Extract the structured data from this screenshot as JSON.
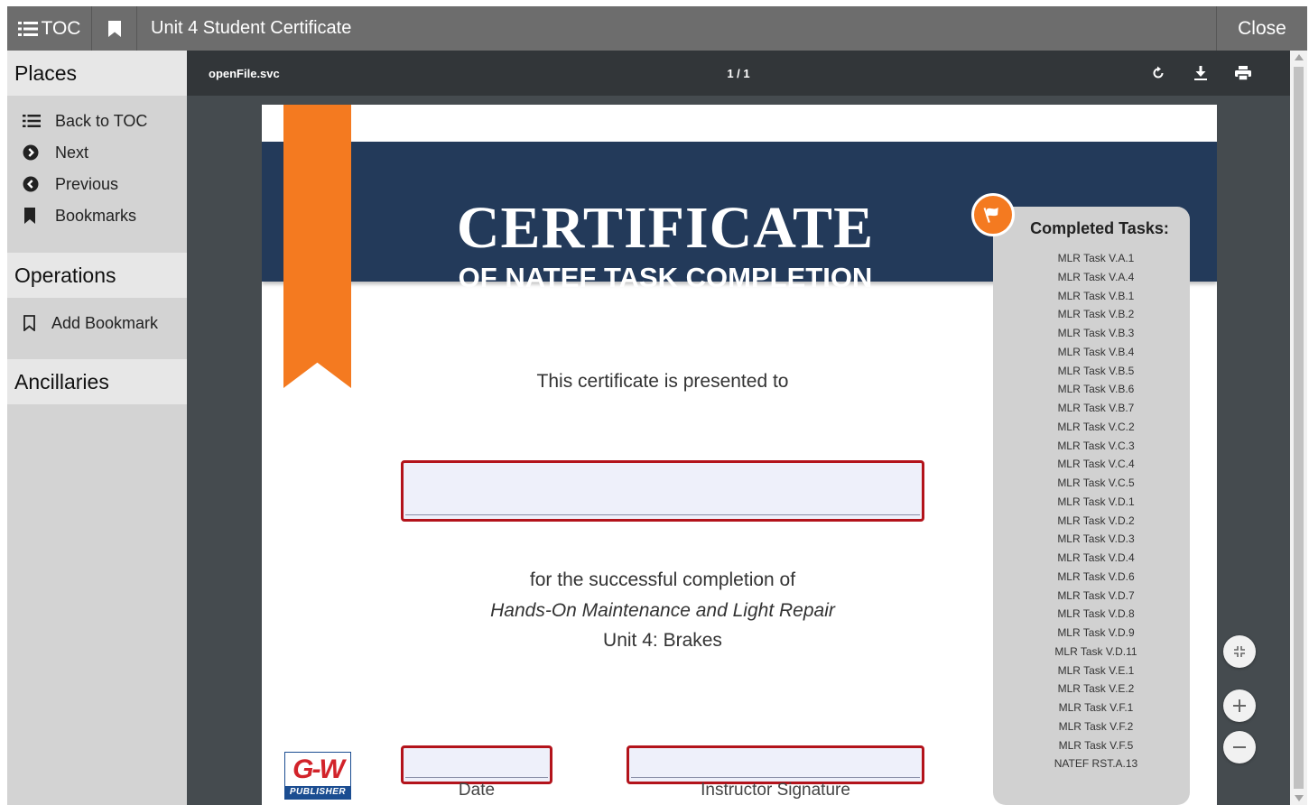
{
  "topbar": {
    "toc_label": "TOC",
    "title": "Unit 4 Student Certificate",
    "close_label": "Close"
  },
  "sidebar": {
    "places_heading": "Places",
    "places_items": [
      {
        "label": "Back to TOC",
        "icon": "list-icon"
      },
      {
        "label": "Next",
        "icon": "next-circle-icon"
      },
      {
        "label": "Previous",
        "icon": "previous-circle-icon"
      },
      {
        "label": "Bookmarks",
        "icon": "bookmark-icon"
      }
    ],
    "operations_heading": "Operations",
    "operations_items": [
      {
        "label": "Add Bookmark",
        "icon": "bookmark-outline-icon"
      }
    ],
    "ancillaries_heading": "Ancillaries"
  },
  "viewer": {
    "file_name": "openFile.svc",
    "page_counter": "1 / 1"
  },
  "certificate": {
    "title": "CERTIFICATE",
    "subtitle": "OF NATEF TASK COMPLETION",
    "presented_to": "This certificate is presented to",
    "completion_line": "for the successful completion of",
    "course": "Hands-On Maintenance and Light Repair",
    "unit": "Unit 4: Brakes",
    "date_label": "Date",
    "signature_label": "Instructor Signature",
    "name_value": "",
    "date_value": "",
    "signature_value": "",
    "tasks_title": "Completed Tasks:",
    "tasks": [
      "MLR Task V.A.1",
      "MLR Task V.A.4",
      "MLR Task V.B.1",
      "MLR Task V.B.2",
      "MLR Task V.B.3",
      "MLR Task V.B.4",
      "MLR Task V.B.5",
      "MLR Task V.B.6",
      "MLR Task V.B.7",
      "MLR Task V.C.2",
      "MLR Task V.C.3",
      "MLR Task V.C.4",
      "MLR Task V.C.5",
      "MLR Task V.D.1",
      "MLR Task V.D.2",
      "MLR Task V.D.3",
      "MLR Task V.D.4",
      "MLR Task V.D.6",
      "MLR Task V.D.7",
      "MLR Task V.D.8",
      "MLR Task V.D.9",
      "MLR Task V.D.11",
      "MLR Task V.E.1",
      "MLR Task V.E.2",
      "MLR Task V.F.1",
      "MLR Task V.F.2",
      "MLR Task V.F.5",
      "NATEF RST.A.13"
    ],
    "logo_text": "G-W",
    "logo_sub": "PUBLISHER"
  },
  "colors": {
    "navy": "#233a5a",
    "orange": "#f47a20",
    "field_border": "#b3131b",
    "toolbar": "#323639",
    "topbar": "#6d6d6d"
  }
}
